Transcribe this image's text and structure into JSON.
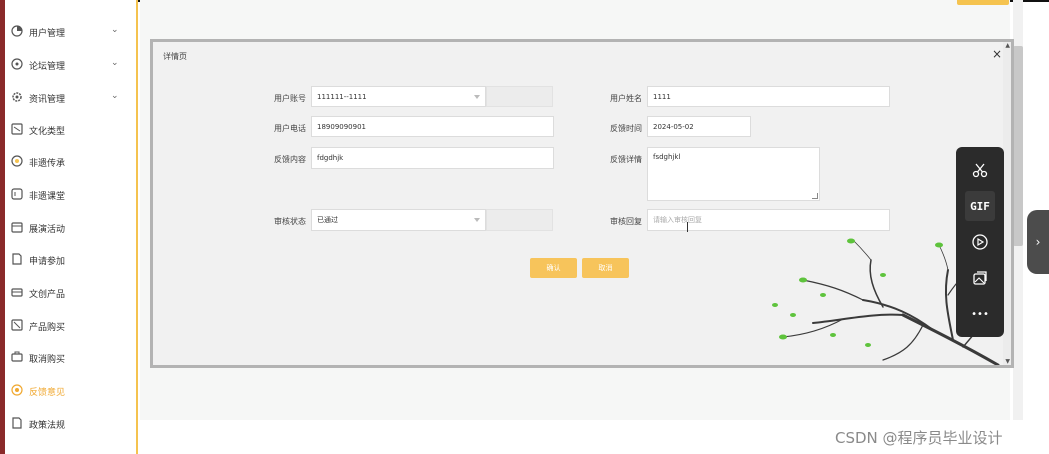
{
  "sidebar": {
    "items": [
      {
        "label": "用户管理",
        "icon": "user-circle-icon",
        "has_children": true
      },
      {
        "label": "论坛管理",
        "icon": "forum-icon",
        "has_children": true
      },
      {
        "label": "资讯管理",
        "icon": "news-gear-icon",
        "has_children": true
      },
      {
        "label": "文化类型",
        "icon": "book-icon",
        "has_children": false
      },
      {
        "label": "非遗传承",
        "icon": "heritage-icon",
        "has_children": false
      },
      {
        "label": "非遗课堂",
        "icon": "classroom-icon",
        "has_children": false
      },
      {
        "label": "展演活动",
        "icon": "calendar-icon",
        "has_children": false
      },
      {
        "label": "申请参加",
        "icon": "document-icon",
        "has_children": false
      },
      {
        "label": "文创产品",
        "icon": "product-icon",
        "has_children": false
      },
      {
        "label": "产品购买",
        "icon": "cart-icon",
        "has_children": false
      },
      {
        "label": "取消购买",
        "icon": "cancel-order-icon",
        "has_children": false
      },
      {
        "label": "反馈意见",
        "icon": "feedback-icon",
        "has_children": false,
        "active": true
      },
      {
        "label": "政策法规",
        "icon": "policy-icon",
        "has_children": false
      }
    ],
    "chevron": "⌄"
  },
  "dialog": {
    "title": "详情页",
    "close": "×",
    "fields": {
      "account_label": "用户账号",
      "account_value": "111111--1111",
      "name_label": "用户姓名",
      "name_value": "1111",
      "phone_label": "用户电话",
      "phone_value": "18909090901",
      "time_label": "反馈时间",
      "time_value": "2024-05-02",
      "content_label": "反馈内容",
      "content_value": "fdgdhjk",
      "detail_label": "反馈详情",
      "detail_value": "fsdghjkl",
      "status_label": "审核状态",
      "status_value": "已通过",
      "reply_label": "审核回复",
      "reply_placeholder": "请输入审核回复"
    },
    "buttons": {
      "confirm": "确认",
      "cancel": "取消"
    }
  },
  "toolbar": {
    "gif_label": "GIF",
    "more_label": "•••",
    "expand_label": "›"
  },
  "watermark": "CSDN @程序员毕业设计",
  "colors": {
    "accent": "#f5c34f",
    "button": "#f7c45b",
    "active_text": "#f0a830",
    "toolbar_bg": "#2b2b2b",
    "leaf_green": "#5ec33c"
  }
}
